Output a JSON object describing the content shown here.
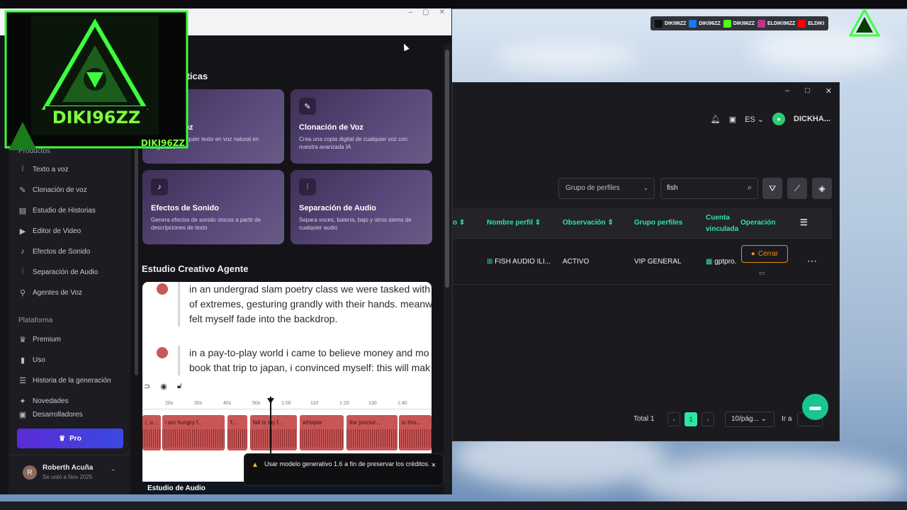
{
  "overlay": {
    "channel_name": "DIKI96ZZ",
    "socials": [
      {
        "icon": "tiktok-icon",
        "handle": "DIKI96ZZ",
        "color": "#111111"
      },
      {
        "icon": "facebook-icon",
        "handle": "DIKI96ZZ",
        "color": "#1877f2"
      },
      {
        "icon": "kick-icon",
        "handle": "DIKI96ZZ",
        "color": "#53fc18"
      },
      {
        "icon": "instagram-icon",
        "handle": "ELDIKI96ZZ",
        "color": "#c13584"
      },
      {
        "icon": "youtube-icon",
        "handle": "ELDIKI",
        "color": "#ff0000"
      }
    ]
  },
  "sidebar": {
    "section_products": "Productos",
    "products": [
      {
        "label": "Texto a voz",
        "icon": "waveform-icon"
      },
      {
        "label": "Clonación de voz",
        "icon": "magic-wand-icon"
      },
      {
        "label": "Estudio de Historias",
        "icon": "book-icon"
      },
      {
        "label": "Editor de Video",
        "icon": "video-icon"
      },
      {
        "label": "Efectos de Sonido",
        "icon": "speaker-icon"
      },
      {
        "label": "Separación de Audio",
        "icon": "split-audio-icon"
      },
      {
        "label": "Agentes de Voz",
        "icon": "agent-icon"
      }
    ],
    "section_platform": "Plataforma",
    "platform": [
      {
        "label": "Premium",
        "icon": "crown-icon"
      },
      {
        "label": "Uso",
        "icon": "chart-icon"
      },
      {
        "label": "Historia de la generación",
        "icon": "history-icon"
      },
      {
        "label": "Novedades",
        "icon": "news-icon"
      }
    ],
    "developers": "Desarrolladores",
    "pro_label": "Pro",
    "user": {
      "initial": "R",
      "name": "Roberth Acuña",
      "joined": "Se unió a Nov 2025"
    }
  },
  "main": {
    "features_title": "Características",
    "features": [
      {
        "title": "Texto a Voz",
        "desc": "Convierte cualquier texto en voz natural en segundos",
        "icon": "waveform-icon"
      },
      {
        "title": "Clonación de Voz",
        "desc": "Crea una copia digital de cualquier voz con nuestra avanzada IA",
        "icon": "magic-wand-icon"
      },
      {
        "title": "Efectos de Sonido",
        "desc": "Genera efectos de sonido únicos a partir de descripciones de texto",
        "icon": "speaker-icon"
      },
      {
        "title": "Separación de Audio",
        "desc": "Separa voces, batería, bajo y otros stems de cualquier audio",
        "icon": "split-audio-icon"
      }
    ],
    "studio_title": "Estudio Creativo Agente",
    "transcript": [
      [
        "in an undergrad slam poetry class we were tasked with",
        "of extremes, gesturing grandly with their hands. meanw",
        "felt myself fade into the backdrop."
      ],
      [
        "in a pay-to-play world i came to believe money and mo",
        "book that trip to japan, i convinced myself: this will mak"
      ]
    ],
    "ruler_ticks": [
      "20s",
      "30s",
      "40s",
      "50s",
      "1:00",
      "110",
      "1:20",
      "130",
      "1:40"
    ],
    "clips": [
      "l, u...",
      "i am hungry f...",
      "f...",
      "fall is my f...",
      "whisper",
      "the junctur...",
      "is this..."
    ],
    "audio_studio_label": "Estudio de Audio"
  },
  "toast": {
    "text": "Usar modelo generativo 1.6 a fin de preservar los créditos.",
    "close": "×"
  },
  "app2": {
    "language": "ES",
    "username": "DICKHA...",
    "group_select": "Grupo de perfiles",
    "search_value": "fish",
    "columns": [
      "Nombre perfil",
      "Observación",
      "Grupo perfiles",
      "Cuenta vinculada",
      "Operación"
    ],
    "row": {
      "name": "FISH AUDIO ILI...",
      "observation": "ACTIVO",
      "group": "VIP GENERAL",
      "account": "gptpro.",
      "action": "Cerrar"
    },
    "total": "Total 1",
    "page": "1",
    "page_size": "10/pág...",
    "goto": "Ir a"
  }
}
